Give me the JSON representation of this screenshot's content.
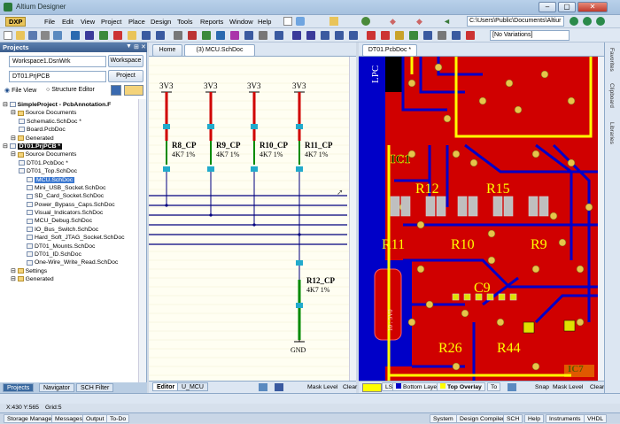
{
  "window": {
    "title": "Altium Designer"
  },
  "menu": {
    "dxp": "DXP",
    "items": [
      "File",
      "Edit",
      "View",
      "Project",
      "Place",
      "Design",
      "Tools",
      "Reports",
      "Window",
      "Help"
    ],
    "path": "C:\\Users\\Public\\Documents\\Altiur",
    "variation": "[No Variations]"
  },
  "projects": {
    "title": "Projects",
    "workspace_value": "Workspace1.DsnWrk",
    "workspace_btn": "Workspace",
    "project_value": "DT01.PrjPCB",
    "project_btn": "Project",
    "fileview": "File View",
    "structure": "Structure Editor",
    "tree": [
      {
        "label": "SimpleProject - PcbAnnotation.F",
        "indent": 0,
        "bold": true
      },
      {
        "label": "Source Documents",
        "indent": 1,
        "folder": true
      },
      {
        "label": "Schematic.SchDoc *",
        "indent": 2
      },
      {
        "label": "Board.PcbDoc",
        "indent": 2
      },
      {
        "label": "Generated",
        "indent": 1,
        "folder": true
      },
      {
        "label": "DT01.PrjPCB *",
        "indent": 0,
        "bold": true,
        "hl": true
      },
      {
        "label": "Source Documents",
        "indent": 1,
        "folder": true
      },
      {
        "label": "DT01.PcbDoc *",
        "indent": 2
      },
      {
        "label": "DT01_Top.SchDoc",
        "indent": 2
      },
      {
        "label": "MCU.SchDoc",
        "indent": 3,
        "sel": true
      },
      {
        "label": "Mini_USB_Socket.SchDoc",
        "indent": 3
      },
      {
        "label": "SD_Card_Socket.SchDoc",
        "indent": 3
      },
      {
        "label": "Power_Bypass_Caps.SchDoc",
        "indent": 3
      },
      {
        "label": "Visual_Indicators.SchDoc",
        "indent": 3
      },
      {
        "label": "MCU_Debug.SchDoc",
        "indent": 3
      },
      {
        "label": "IO_Bus_Switch.SchDoc",
        "indent": 3
      },
      {
        "label": "Hard_Soft_JTAG_Socket.SchDoc",
        "indent": 3
      },
      {
        "label": "DT01_Mounts.SchDoc",
        "indent": 3
      },
      {
        "label": "DT01_ID.SchDoc",
        "indent": 3
      },
      {
        "label": "One-Wire_Write_Read.SchDoc",
        "indent": 3
      },
      {
        "label": "Settings",
        "indent": 1,
        "folder": true
      },
      {
        "label": "Generated",
        "indent": 1,
        "folder": true
      }
    ],
    "tabs": [
      "Projects",
      "Navigator",
      "SCH Filter"
    ]
  },
  "sch": {
    "home": "Home",
    "tab": "(3) MCU.SchDoc",
    "nets": [
      "3V3",
      "3V3",
      "3V3",
      "3V3"
    ],
    "resistors": [
      {
        "name": "R8_CP",
        "value": "4K7 1%"
      },
      {
        "name": "R9_CP",
        "value": "4K7 1%"
      },
      {
        "name": "R10_CP",
        "value": "4K7 1%"
      },
      {
        "name": "R11_CP",
        "value": "4K7 1%"
      }
    ],
    "r12": {
      "name": "R12_CP",
      "value": "4K7 1%"
    },
    "gnd": "GND",
    "bottom_tabs": [
      "Editor",
      "U_MCU"
    ],
    "mask": "Mask Level",
    "clear": "Clear"
  },
  "pcb": {
    "tab": "DT01.PcbDoc *",
    "labels": {
      "ic1": "IC1",
      "r12": "R12",
      "r15": "R15",
      "r11": "R11",
      "r10": "R10",
      "r9": "R9",
      "c9": "C9",
      "r26": "R26",
      "r44": "R44",
      "ic7": "IC7",
      "lpc": "LPC",
      "vo": "10 : 5V0"
    },
    "layers": [
      "LS",
      "Bottom Layer",
      "Top Overlay",
      "To"
    ],
    "snap": "Snap",
    "mask": "Mask Level",
    "clear": "Clear"
  },
  "rightbar": [
    "Favorites",
    "Clipboard",
    "Libraries"
  ],
  "status": {
    "coords": "X:430 Y:565",
    "grid": "Grid:5",
    "left": [
      "Storage Manager",
      "Messages",
      "Output",
      "To-Do"
    ],
    "right": [
      "System",
      "Design Compiler",
      "SCH",
      "Help",
      "Instruments",
      "VHDL"
    ]
  },
  "colors": {
    "board": "#e10000",
    "trace": "#0000c8",
    "silk": "#ffff00",
    "pad": "#c0c0c0"
  }
}
